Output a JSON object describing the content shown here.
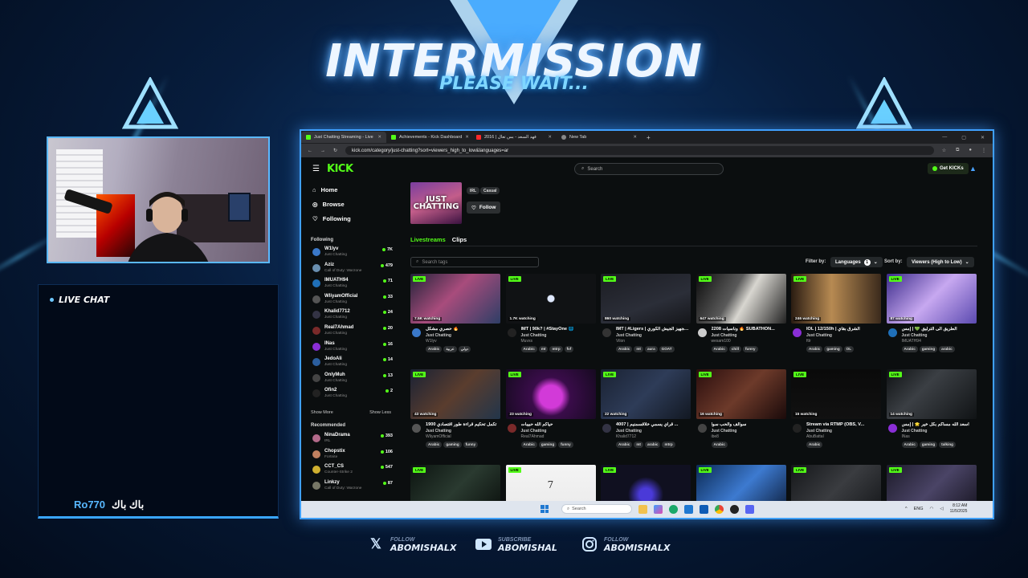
{
  "overlay": {
    "title": "INTERMISSION",
    "subtitle": "PLEASE WAIT...",
    "chat_header": "LIVE CHAT",
    "chat_message": {
      "user": "Ro770",
      "text": "باك باك"
    },
    "socials": [
      {
        "label": "FOLLOW",
        "handle": "ABOMISHALX",
        "icon": "x-icon"
      },
      {
        "label": "SUBSCRIBE",
        "handle": "ABOMISHAL",
        "icon": "youtube-icon"
      },
      {
        "label": "FOLLOW",
        "handle": "ABOMISHALX",
        "icon": "instagram-icon"
      }
    ]
  },
  "browser": {
    "tabs": [
      {
        "label": "Just Chatting Streaming - Live",
        "active": true
      },
      {
        "label": "Achievements - Kick Dashboard",
        "active": false
      },
      {
        "label": "2016 | فهد السعد - بس تعال",
        "active": false
      },
      {
        "label": "New Tab",
        "active": false
      }
    ],
    "url": "kick.com/category/just-chatting?sort=viewers_high_to_low&languages=ar"
  },
  "kick": {
    "logo": "KICK",
    "search_placeholder": "Search",
    "get_kicks": "Get KICKs",
    "nav": [
      {
        "label": "Home",
        "icon": "home-icon"
      },
      {
        "label": "Browse",
        "icon": "compass-icon"
      },
      {
        "label": "Following",
        "icon": "heart-icon"
      }
    ],
    "following_heading": "Following",
    "following": [
      {
        "name": "W1lyv",
        "category": "Just Chatting",
        "viewers": "7K",
        "color": "#3a78c9"
      },
      {
        "name": "Aziz",
        "category": "Call of Duty: Warzone",
        "viewers": "479",
        "color": "#6a8fb0"
      },
      {
        "name": "IMUATH94",
        "category": "Just Chatting",
        "viewers": "71",
        "color": "#1f6fb8"
      },
      {
        "name": "WliyamOfficial",
        "category": "Just Chatting",
        "viewers": "33",
        "color": "#555"
      },
      {
        "name": "Khalid7712",
        "category": "Just Chatting",
        "viewers": "24",
        "color": "#334"
      },
      {
        "name": "Real7Ahmad",
        "category": "Just Chatting",
        "viewers": "20",
        "color": "#7a2a2a"
      },
      {
        "name": "INas",
        "category": "Just Chatting",
        "viewers": "16",
        "color": "#8a2ed6"
      },
      {
        "name": "JedoAli",
        "category": "Just Chatting",
        "viewers": "14",
        "color": "#2b5e9e"
      },
      {
        "name": "OnlyMuh",
        "category": "Just Chatting",
        "viewers": "13",
        "color": "#444"
      },
      {
        "name": "Ofin2",
        "category": "Just Chatting",
        "viewers": "2",
        "color": "#222"
      }
    ],
    "show_more": "Show More",
    "show_less": "Show Less",
    "recommended_heading": "Recommended",
    "recommended": [
      {
        "name": "NinaDrama",
        "category": "IRL",
        "viewers": "393",
        "color": "#b36a8a"
      },
      {
        "name": "Chopstix",
        "category": "Fortnite",
        "viewers": "106",
        "color": "#c08060"
      },
      {
        "name": "CCT_CS",
        "category": "Counter-Strike 2",
        "viewers": "547",
        "color": "#d0b030"
      },
      {
        "name": "Linkzy",
        "category": "Call of Duty: Warzone",
        "viewers": "87",
        "color": "#776"
      }
    ],
    "category": {
      "art_label": "JUST CHATTING",
      "tags": [
        "IRL",
        "Casual"
      ],
      "follow_label": "Follow",
      "tabs": [
        "Livestreams",
        "Clips"
      ]
    },
    "tag_search_placeholder": "Search tags",
    "filter_by_label": "Filter by:",
    "languages_label": "Languages",
    "languages_count": "1",
    "sort_by_label": "Sort by:",
    "sort_value": "Viewers (High to Low)",
    "live_label": "LIVE",
    "streams": [
      {
        "watching": "7.5K watching",
        "title": "حصري مشكل 🔥",
        "category": "Just Chatting",
        "user": "W1lyv",
        "tags": [
          "Arabic",
          "عربية",
          "دولي"
        ],
        "thumb": "linear-gradient(135deg,#23233a,#a84c7c 45%,#2e3e66)",
        "av": "#3a78c9"
      },
      {
        "watching": "1.7K watching",
        "title": "IMT | 90k? | #StayOne 🌐",
        "category": "Just Chatting",
        "user": "Muvxs",
        "tags": [
          "Arabic",
          "mt",
          "mtrp",
          "fvf"
        ],
        "thumb": "radial-gradient(circle at 50% 50%,#dfe9ff 0 4px,#101214 5px)",
        "av": "#222"
      },
      {
        "watching": "860 watching",
        "title": "IMT | #Ligers | وتجهيز الجيش الكوري ...",
        "category": "Just Chatting",
        "user": "Vilon",
        "tags": [
          "Arabic",
          "mt",
          "aura",
          "GOAT"
        ],
        "thumb": "linear-gradient(160deg,#1c1d23,#2b2e38 60%,#15161a)",
        "av": "#333"
      },
      {
        "watching": "647 watching",
        "title": "2208 وناسيات 🔥 SUBATHON...",
        "category": "Just Chatting",
        "user": "wesam100",
        "tags": [
          "Arabic",
          "chill",
          "funny"
        ],
        "thumb": "linear-gradient(120deg,#0d0d0d,#5a5a5a 40%,#d8d6d0 55%,#222)",
        "av": "#ccc"
      },
      {
        "watching": "246 watching",
        "title": "IOL | 12/150h | الشرق بقاي",
        "category": "Just Chatting",
        "user": "ftlr",
        "tags": [
          "Arabic",
          "gaming",
          "OL"
        ],
        "thumb": "linear-gradient(90deg,#2a1c12,#b78a52 45%,#3b2a1c)",
        "av": "#8a2ed6"
      },
      {
        "watching": "87 watching",
        "title": "الطريق الى الترليق 💚 | إمس",
        "category": "Just Chatting",
        "user": "IMUATH94",
        "tags": [
          "Arabic",
          "gaming",
          "arabic"
        ],
        "thumb": "linear-gradient(135deg,#3b2b8a,#c7a8f0 50%,#5b4ab0)",
        "av": "#1f6fb8"
      },
      {
        "watching": "43 watching",
        "title": "تكمل تحكيم قراءة طور اقتصادي 1900",
        "category": "Just Chatting",
        "user": "WliyamOfficial",
        "tags": [
          "Arabic",
          "gaming",
          "funny"
        ],
        "thumb": "linear-gradient(135deg,#1a2235,#5a3d2e 50%,#22354a)",
        "av": "#555"
      },
      {
        "watching": "23 watching",
        "title": "حياكم الله حبيبات",
        "category": "Just Chatting",
        "user": "Real7Ahmad",
        "tags": [
          "Arabic",
          "gaming",
          "funny"
        ],
        "thumb": "radial-gradient(circle at 50% 55%,#d23ad8 0 14px,#3a0c4a 24px,#160a20)",
        "av": "#7a2a2a"
      },
      {
        "watching": "22 watching",
        "title": "4007 | قراي يسمي ‌خلاقسمنيم ...",
        "category": "Just Chatting",
        "user": "Khalid7712",
        "tags": [
          "Arabic",
          "mt",
          "arabic",
          "mtrp"
        ],
        "thumb": "linear-gradient(135deg,#1a2233,#2e3c58 50%,#121822)",
        "av": "#334"
      },
      {
        "watching": "16 watching",
        "title": "سوالف والحب سوا",
        "category": "Just Chatting",
        "user": "ibe8",
        "tags": [
          "Arabic"
        ],
        "thumb": "linear-gradient(135deg,#2a0e0e,#6d3a2a 50%,#1a0a0a)",
        "av": "#444"
      },
      {
        "watching": "15 watching",
        "title": "Stream via RTMP (OBS, V...",
        "category": "Just Chatting",
        "user": "AbuBattal",
        "tags": [
          "Arabic"
        ],
        "thumb": "linear-gradient(180deg,#0a0a0a,#111)",
        "av": "#222"
      },
      {
        "watching": "14 watching",
        "title": "أسعد الله مساكم بكل خير 🌟 | إمس",
        "category": "Just Chatting",
        "user": "INas",
        "tags": [
          "Arabic",
          "gaming",
          "talking"
        ],
        "thumb": "linear-gradient(135deg,#0f1214,#3b3f44 40%,#101315)",
        "av": "#8a2ed6"
      },
      {
        "watching": "",
        "title": "",
        "category": "",
        "user": "",
        "tags": [],
        "thumb": "linear-gradient(135deg,#0c1410,#2a3a30 50%,#0a0f0c)",
        "av": "#000"
      },
      {
        "watching": "",
        "title": "",
        "category": "",
        "user": "",
        "tags": [],
        "thumb": "linear-gradient(180deg,#f4f4f4,#eaeaea)",
        "av": "#000",
        "glyph": "7"
      },
      {
        "watching": "",
        "title": "",
        "category": "",
        "user": "",
        "tags": [],
        "thumb": "radial-gradient(circle at 50% 60%,#4a3ad8 0 8px,#101020 22px)",
        "av": "#000"
      },
      {
        "watching": "",
        "title": "",
        "category": "",
        "user": "",
        "tags": [],
        "thumb": "linear-gradient(135deg,#0b2a55,#3d7ad0 50%,#0b1a35)",
        "av": "#000"
      },
      {
        "watching": "",
        "title": "",
        "category": "",
        "user": "",
        "tags": [],
        "thumb": "linear-gradient(135deg,#15171a,#3a3c40 50%,#15171a)",
        "av": "#000"
      },
      {
        "watching": "",
        "title": "",
        "category": "",
        "user": "",
        "tags": [],
        "thumb": "linear-gradient(135deg,#1d1b2a,#4a4466 50%,#15131e)",
        "av": "#000"
      }
    ]
  },
  "taskbar": {
    "search_placeholder": "Search",
    "lang": "ENG",
    "time": "8:12 AM",
    "date": "11/5/2025"
  },
  "colors": {
    "accent": "#53fc18",
    "frame": "#3fa0ff",
    "chat_user": "#58b8ff"
  }
}
